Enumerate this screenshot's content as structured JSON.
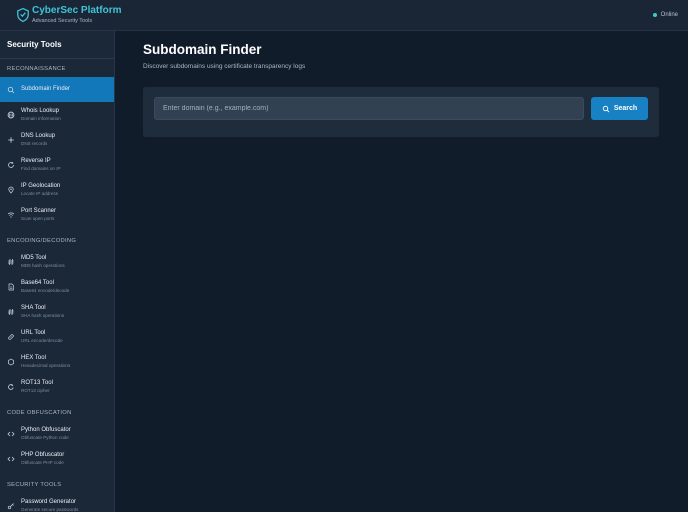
{
  "header": {
    "title": "CyberSec Platform",
    "subtitle": "Advanced Security Tools",
    "status": "Online",
    "accent": "#3fc3d9"
  },
  "sidebar": {
    "title": "Security Tools",
    "sections": [
      {
        "title": "RECONNAISSANCE",
        "items": [
          {
            "label": "Subdomain Finder",
            "desc": "",
            "icon": "search-icon",
            "active": true
          },
          {
            "label": "Whois Lookup",
            "desc": "Domain information",
            "icon": "globe-icon"
          },
          {
            "label": "DNS Lookup",
            "desc": "DNS records",
            "icon": "network-icon"
          },
          {
            "label": "Reverse IP",
            "desc": "Find domains on IP",
            "icon": "refresh-icon"
          },
          {
            "label": "IP Geolocation",
            "desc": "Locate IP address",
            "icon": "map-pin-icon"
          },
          {
            "label": "Port Scanner",
            "desc": "Scan open ports",
            "icon": "wifi-icon"
          }
        ]
      },
      {
        "title": "ENCODING/DECODING",
        "items": [
          {
            "label": "MD5 Tool",
            "desc": "MD5 hash operations",
            "icon": "hash-icon"
          },
          {
            "label": "Base64 Tool",
            "desc": "Base64 encode/decode",
            "icon": "file-icon"
          },
          {
            "label": "SHA Tool",
            "desc": "SHA hash operations",
            "icon": "hash-icon"
          },
          {
            "label": "URL Tool",
            "desc": "URL encode/decode",
            "icon": "link-icon"
          },
          {
            "label": "HEX Tool",
            "desc": "Hexadecimal operations",
            "icon": "hexagon-icon"
          },
          {
            "label": "ROT13 Tool",
            "desc": "ROT13 cipher",
            "icon": "rotate-icon"
          }
        ]
      },
      {
        "title": "CODE OBFUSCATION",
        "items": [
          {
            "label": "Python Obfuscator",
            "desc": "Obfuscate Python code",
            "icon": "code-icon"
          },
          {
            "label": "PHP Obfuscator",
            "desc": "Obfuscate PHP code",
            "icon": "code-icon"
          }
        ]
      },
      {
        "title": "SECURITY TOOLS",
        "items": [
          {
            "label": "Password Generator",
            "desc": "Generate secure passwords",
            "icon": "key-icon"
          }
        ]
      }
    ]
  },
  "main": {
    "title": "Subdomain Finder",
    "subtitle": "Discover subdomains using certificate transparency logs",
    "input_placeholder": "Enter domain (e.g., example.com)",
    "search_label": "Search"
  }
}
